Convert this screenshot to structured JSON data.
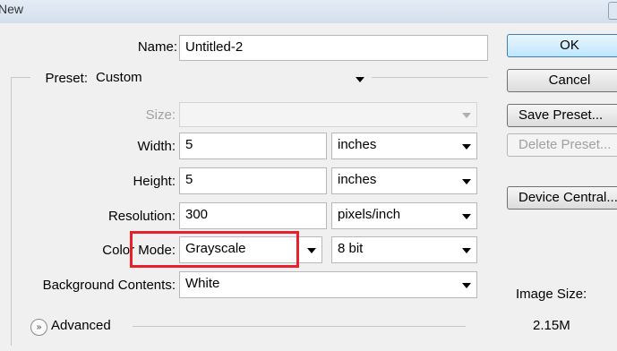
{
  "window": {
    "title": "New"
  },
  "form": {
    "name": {
      "label": "Name:",
      "value": "Untitled-2"
    },
    "preset": {
      "label": "Preset:",
      "value": "Custom"
    },
    "size": {
      "label": "Size:",
      "value": ""
    },
    "width": {
      "label": "Width:",
      "value": "5",
      "unit": "inches"
    },
    "height": {
      "label": "Height:",
      "value": "5",
      "unit": "inches"
    },
    "resolution": {
      "label": "Resolution:",
      "value": "300",
      "unit": "pixels/inch"
    },
    "color_mode": {
      "label": "Color Mode:",
      "value": "Grayscale",
      "bit_depth": "8 bit"
    },
    "background": {
      "label": "Background Contents:",
      "value": "White"
    },
    "advanced": {
      "label": "Advanced",
      "icon": "chevron-double-down-icon"
    }
  },
  "buttons": {
    "ok": "OK",
    "cancel": "Cancel",
    "save_preset": "Save Preset...",
    "delete_preset": "Delete Preset...",
    "device_central": "Device Central..."
  },
  "image_size": {
    "label": "Image Size:",
    "value": "2.15M"
  },
  "colors": {
    "highlight": "#e8202a",
    "ok_accent": "#3c7fb1"
  }
}
